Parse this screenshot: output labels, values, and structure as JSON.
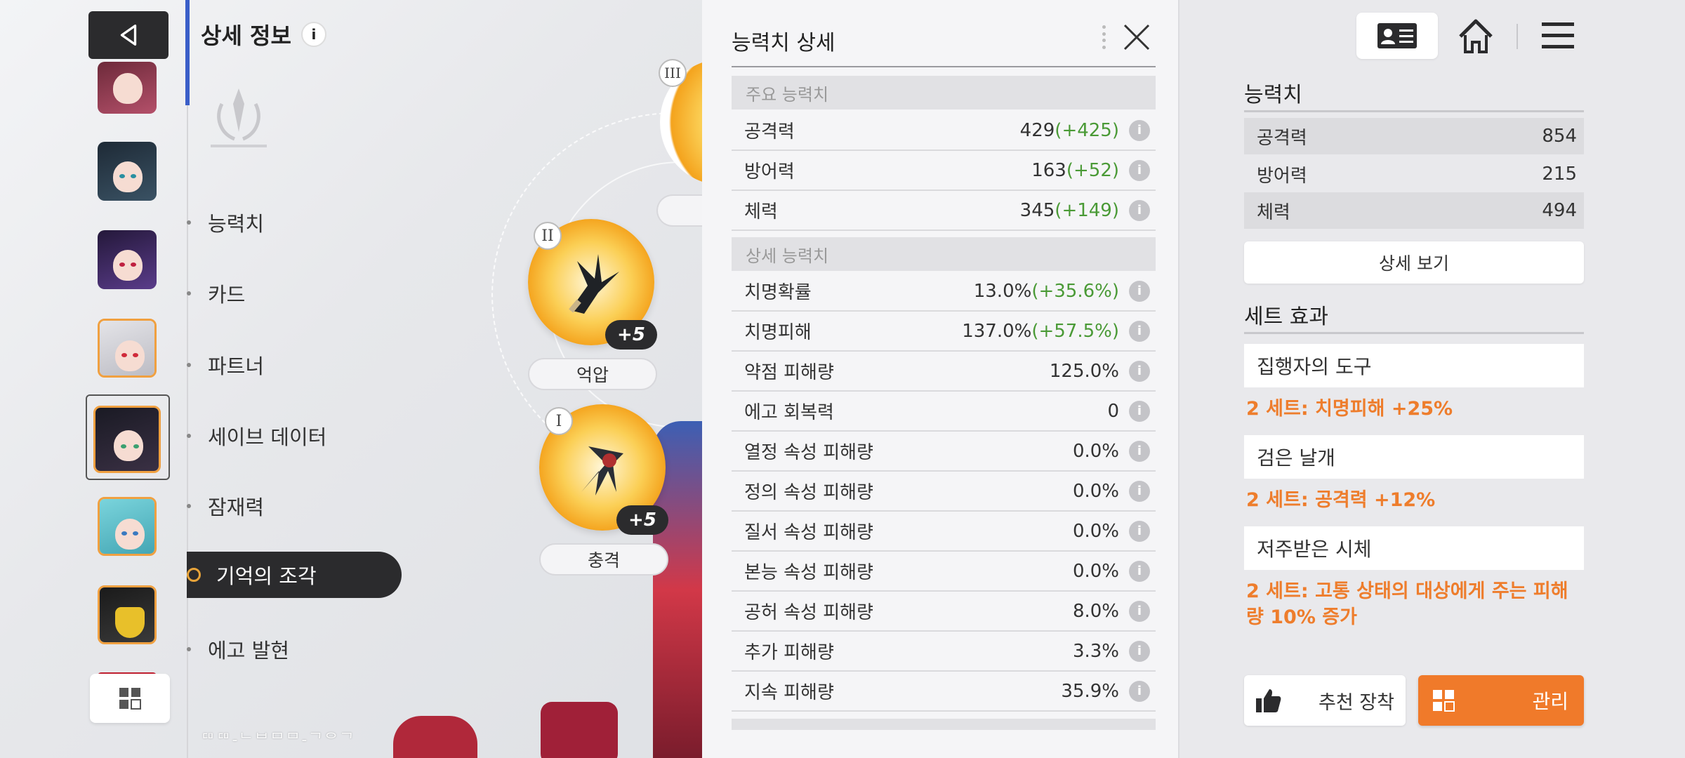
{
  "detail": {
    "title": "상세 정보",
    "info_glyph": "i"
  },
  "menu": [
    {
      "label": "능력치"
    },
    {
      "label": "카드"
    },
    {
      "label": "파트너"
    },
    {
      "label": "세이브 데이터"
    },
    {
      "label": "잠재력"
    },
    {
      "label": "기억의 조각",
      "active": true
    },
    {
      "label": "에고 발현"
    }
  ],
  "watermark": "ᄃᄆᄃᄆ-ᄂᄇᄆᄆ-ᄀᄋᄀ",
  "fragments": [
    {
      "roman": "III"
    },
    {
      "roman": "II",
      "plus": "+5",
      "label": "억압"
    },
    {
      "roman": "I",
      "plus": "+5",
      "label": "충격"
    }
  ],
  "stats_panel": {
    "title": "능력치 상세",
    "main_section": "주요 능력치",
    "detail_section": "상세 능력치",
    "info_glyph": "i",
    "main_rows": [
      {
        "name": "공격력",
        "value": "429",
        "bonus": "(+425)"
      },
      {
        "name": "방어력",
        "value": "163",
        "bonus": "(+52)"
      },
      {
        "name": "체력",
        "value": "345",
        "bonus": "(+149)"
      }
    ],
    "detail_rows": [
      {
        "name": "치명확률",
        "value": "13.0%",
        "bonus": "(+35.6%)"
      },
      {
        "name": "치명피해",
        "value": "137.0%",
        "bonus": "(+57.5%)"
      },
      {
        "name": "약점 피해량",
        "value": "125.0%",
        "bonus": ""
      },
      {
        "name": "에고 회복력",
        "value": "0",
        "bonus": ""
      },
      {
        "name": "열정 속성 피해량",
        "value": "0.0%",
        "bonus": ""
      },
      {
        "name": "정의 속성 피해량",
        "value": "0.0%",
        "bonus": ""
      },
      {
        "name": "질서 속성 피해량",
        "value": "0.0%",
        "bonus": ""
      },
      {
        "name": "본능 속성 피해량",
        "value": "0.0%",
        "bonus": ""
      },
      {
        "name": "공허 속성 피해량",
        "value": "8.0%",
        "bonus": ""
      },
      {
        "name": "추가 피해량",
        "value": "3.3%",
        "bonus": ""
      },
      {
        "name": "지속 피해량",
        "value": "35.9%",
        "bonus": ""
      }
    ]
  },
  "right_panel": {
    "stats_title": "능력치",
    "stats": [
      {
        "name": "공격력",
        "value": "854"
      },
      {
        "name": "방어력",
        "value": "215"
      },
      {
        "name": "체력",
        "value": "494"
      }
    ],
    "detail_button": "상세 보기",
    "set_title": "세트 효과",
    "sets": [
      {
        "name": "집행자의 도구",
        "effect": "2 세트: 치명피해 +25%"
      },
      {
        "name": "검은 날개",
        "effect": "2 세트: 공격력 +12%"
      },
      {
        "name": "저주받은 시체",
        "effect": "2 세트: 고통 상태의 대상에게 주는 피해량 10% 증가"
      }
    ],
    "recommend_button": "추천 장착",
    "manage_button": "관리"
  },
  "colors": {
    "accent_blue": "#3a5ec8",
    "bonus_green": "#4a9a36",
    "orange": "#f07a2a",
    "dark": "#2b2b2d"
  }
}
